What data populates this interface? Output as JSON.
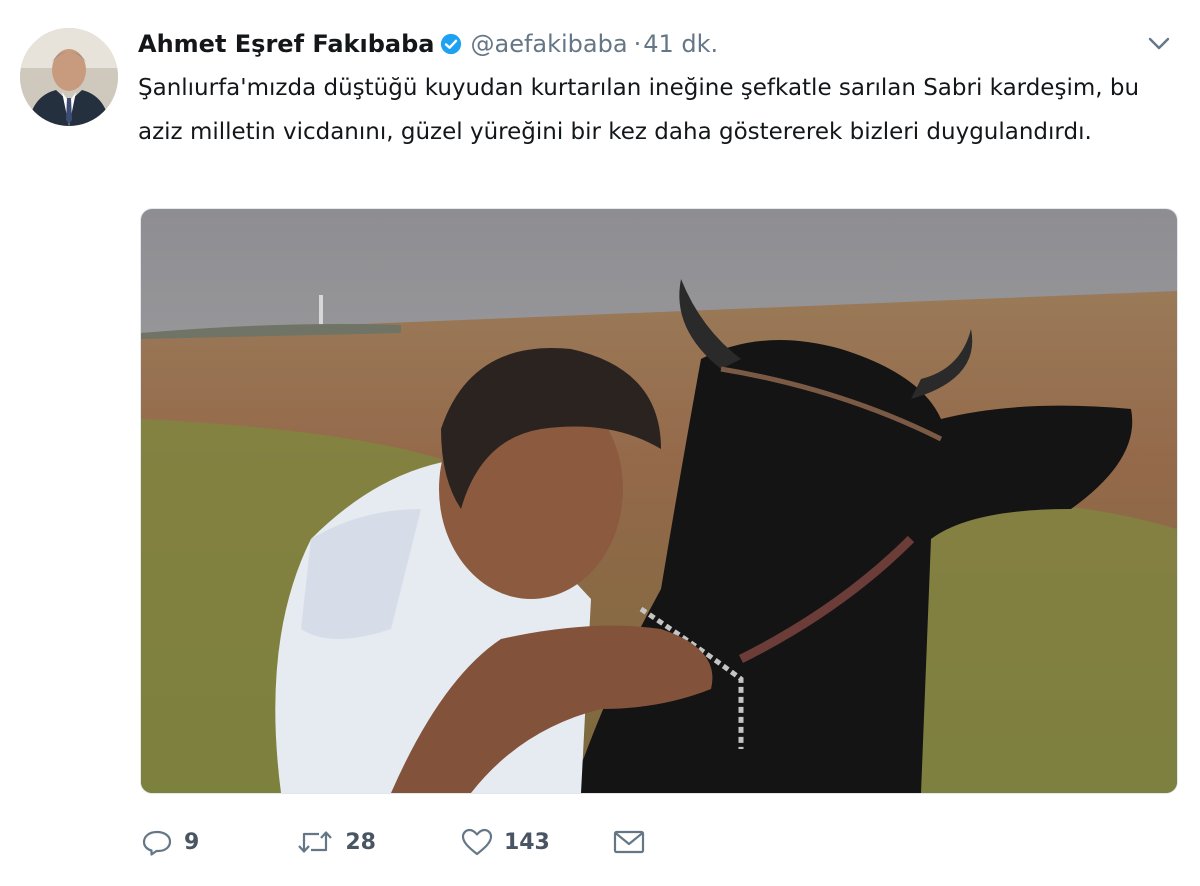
{
  "author": {
    "name": "Ahmet Eşref Fakıbaba",
    "handle": "@aefakibaba",
    "separator": "·",
    "time": "41 dk.",
    "verified_color": "#1da1f2"
  },
  "tweet": {
    "text": "Şanlıurfa'mızda düştüğü kuyudan kurtarılan ineğine şefkatle sarılan Sabri kardeşim, bu aziz milletin vicdanını, güzel yüreğini bir kez daha göstererek bizleri duygulandırdı."
  },
  "actions": {
    "replies": "9",
    "retweets": "28",
    "likes": "143"
  },
  "icons": {
    "menu": "chevron-down-icon",
    "reply": "reply-icon",
    "retweet": "retweet-icon",
    "like": "heart-icon",
    "message": "envelope-icon"
  }
}
